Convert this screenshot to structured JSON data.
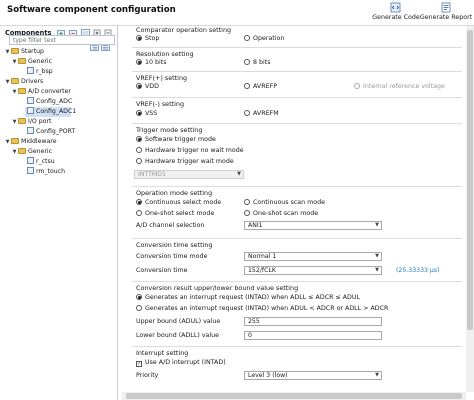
{
  "header": {
    "title": "Software component configuration",
    "generate_code": "Generate Code",
    "generate_report": "Generate Report"
  },
  "components": {
    "label": "Components",
    "filter_placeholder": "type filter text",
    "tree": [
      {
        "label": "Startup",
        "kind": "folder",
        "level": 0,
        "expanded": true
      },
      {
        "label": "Generic",
        "kind": "folder",
        "level": 1,
        "expanded": true
      },
      {
        "label": "r_bsp",
        "kind": "leaf",
        "level": 2
      },
      {
        "label": "Drivers",
        "kind": "folder",
        "level": 0,
        "expanded": true
      },
      {
        "label": "A/D converter",
        "kind": "folder",
        "level": 1,
        "expanded": true
      },
      {
        "label": "Config_ADC",
        "kind": "leaf",
        "level": 2
      },
      {
        "label": "Config_ADC1",
        "kind": "leaf",
        "level": 2,
        "selected": true
      },
      {
        "label": "I/O port",
        "kind": "folder",
        "level": 1,
        "expanded": true
      },
      {
        "label": "Config_PORT",
        "kind": "leaf",
        "level": 2
      },
      {
        "label": "Middleware",
        "kind": "folder",
        "level": 0,
        "expanded": true
      },
      {
        "label": "Generic",
        "kind": "folder",
        "level": 1,
        "expanded": true
      },
      {
        "label": "r_ctsu",
        "kind": "leaf",
        "level": 2
      },
      {
        "label": "rm_touch",
        "kind": "leaf",
        "level": 2
      }
    ]
  },
  "settings": {
    "comparator": {
      "title": "Comparator operation setting",
      "opt1": "Stop",
      "opt2": "Operation"
    },
    "resolution": {
      "title": "Resolution setting",
      "opt1": "10 bits",
      "opt2": "8 bits"
    },
    "vref_plus": {
      "title": "VREF(+) setting",
      "opt1": "VDD",
      "opt2": "AVREFP",
      "opt3": "Internal reference voltage"
    },
    "vref_minus": {
      "title": "VREF(-) setting",
      "opt1": "VSS",
      "opt2": "AVREFM"
    },
    "trigger": {
      "title": "Trigger mode setting",
      "opt1": "Software trigger mode",
      "opt2": "Hardware trigger no wait mode",
      "opt3": "Hardware trigger wait mode",
      "select_value": "INTTMD1"
    },
    "operation": {
      "title": "Operation mode setting",
      "opt1": "Continuous select mode",
      "opt2": "Continuous scan mode",
      "opt3": "One-shot select mode",
      "opt4": "One-shot scan mode",
      "channel_label": "A/D channel selection",
      "channel_value": "ANI1"
    },
    "conversion": {
      "title": "Conversion time setting",
      "mode_label": "Conversion time mode",
      "mode_value": "Normal 1",
      "time_label": "Conversion time",
      "time_value": "152/fCLK",
      "time_note": "(25.33333 μs)"
    },
    "bounds": {
      "title": "Conversion result upper/lower bound value setting",
      "opt1": "Generates an interrupt request (INTAD) when ADLL ≤ ADCR ≤ ADUL",
      "opt2": "Generates an interrupt request (INTAD) when ADUL < ADCR or ADLL > ADCR",
      "upper_label": "Upper bound (ADUL) value",
      "upper_value": "255",
      "lower_label": "Lower bound (ADLL) value",
      "lower_value": "0"
    },
    "interrupt": {
      "title": "Interrupt setting",
      "use_label": "Use A/D interrupt (INTAD)",
      "priority_label": "Priority",
      "priority_value": "Level 3 (low)"
    }
  }
}
